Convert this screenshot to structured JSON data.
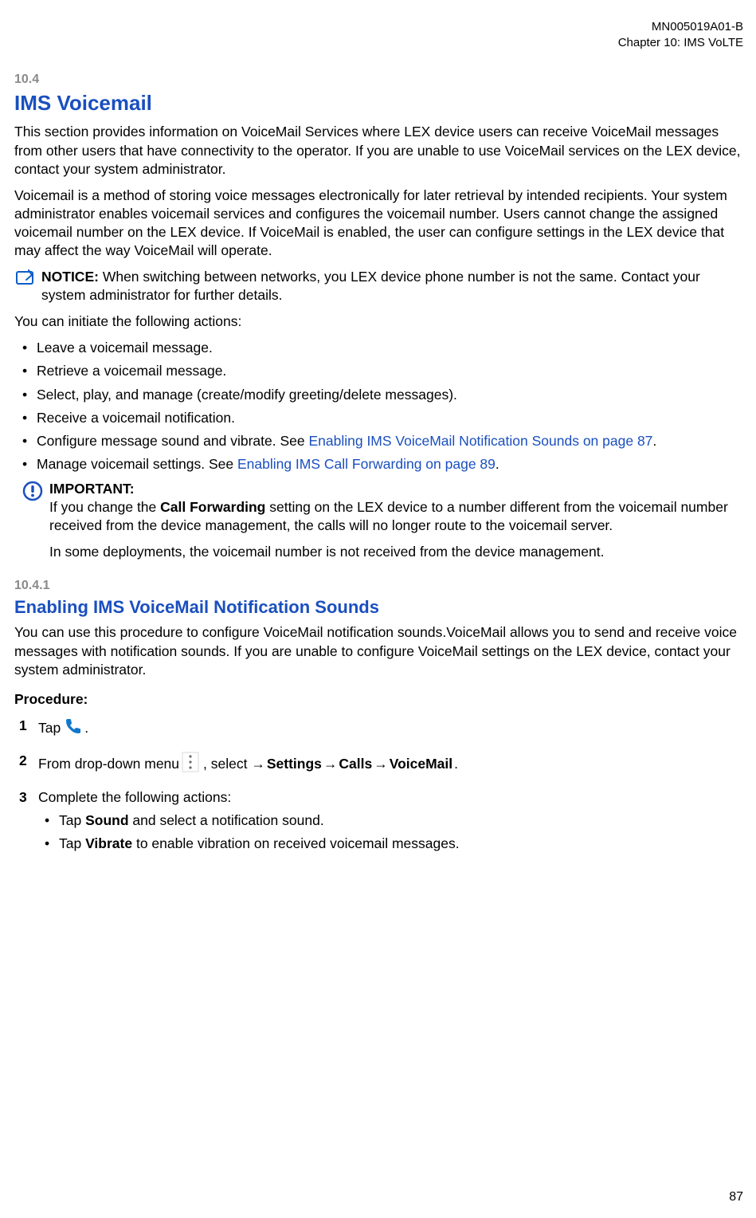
{
  "header": {
    "doc_id": "MN005019A01-B",
    "chapter_line": "Chapter 10:  IMS VoLTE"
  },
  "section_10_4": {
    "num": "10.4",
    "title": "IMS Voicemail",
    "p1": "This section provides information on VoiceMail Services where LEX device users can receive VoiceMail messages from other users that have connectivity to the operator. If you are unable to use VoiceMail services on the LEX device, contact your system administrator.",
    "p2": "Voicemail is a method of storing voice messages electronically for later retrieval by intended recipients. Your system administrator enables voicemail services and configures the voicemail number. Users cannot change the assigned voicemail number on the LEX device. If VoiceMail is enabled, the user can configure settings in the LEX device that may affect the way VoiceMail will operate.",
    "notice_lead": "NOTICE: ",
    "notice_body": "When switching between networks, you LEX device phone number is not the same. Contact your system administrator for further details.",
    "p3": "You can initiate the following actions:",
    "bullets": {
      "b1": "Leave a voicemail message.",
      "b2": "Retrieve a voicemail message.",
      "b3": "Select, play, and manage (create/modify greeting/delete messages).",
      "b4": "Receive a voicemail notification.",
      "b5a": "Configure message sound and vibrate. See ",
      "b5_link": "Enabling IMS VoiceMail Notification Sounds on page 87",
      "b5b": ".",
      "b6a": "Manage voicemail settings. See ",
      "b6_link": "Enabling IMS Call Forwarding on page 89",
      "b6b": "."
    },
    "important_lead": "IMPORTANT:",
    "important_body_a": "If you change the ",
    "important_body_bold": "Call Forwarding",
    "important_body_b": " setting on the LEX device to a number different from the voicemail number received from the device management, the calls will no longer route to the voicemail server.",
    "important_body2": "In some deployments, the voicemail number is not received from the device management."
  },
  "section_10_4_1": {
    "num": "10.4.1",
    "title": "Enabling IMS VoiceMail Notification Sounds",
    "p1": "You can use this procedure to configure VoiceMail notification sounds.VoiceMail allows you to send and receive voice messages with notification sounds. If you are unable to configure VoiceMail settings on the LEX device, contact your system administrator.",
    "proc_label": "Procedure:",
    "step1_a": "Tap ",
    "step1_b": ".",
    "step2_a": "From drop-down menu ",
    "step2_b": " , select → ",
    "step2_s": "Settings",
    "step2_arrow1": " → ",
    "step2_c": "Calls",
    "step2_arrow2": " → ",
    "step2_v": "VoiceMail",
    "step2_end": ".",
    "step3": "Complete the following actions:",
    "sub_a_1": "Tap ",
    "sub_a_bold": "Sound",
    "sub_a_2": " and select a notification sound.",
    "sub_b_1": "Tap ",
    "sub_b_bold": "Vibrate",
    "sub_b_2": " to enable vibration on received voicemail messages."
  },
  "pagenum": "87"
}
